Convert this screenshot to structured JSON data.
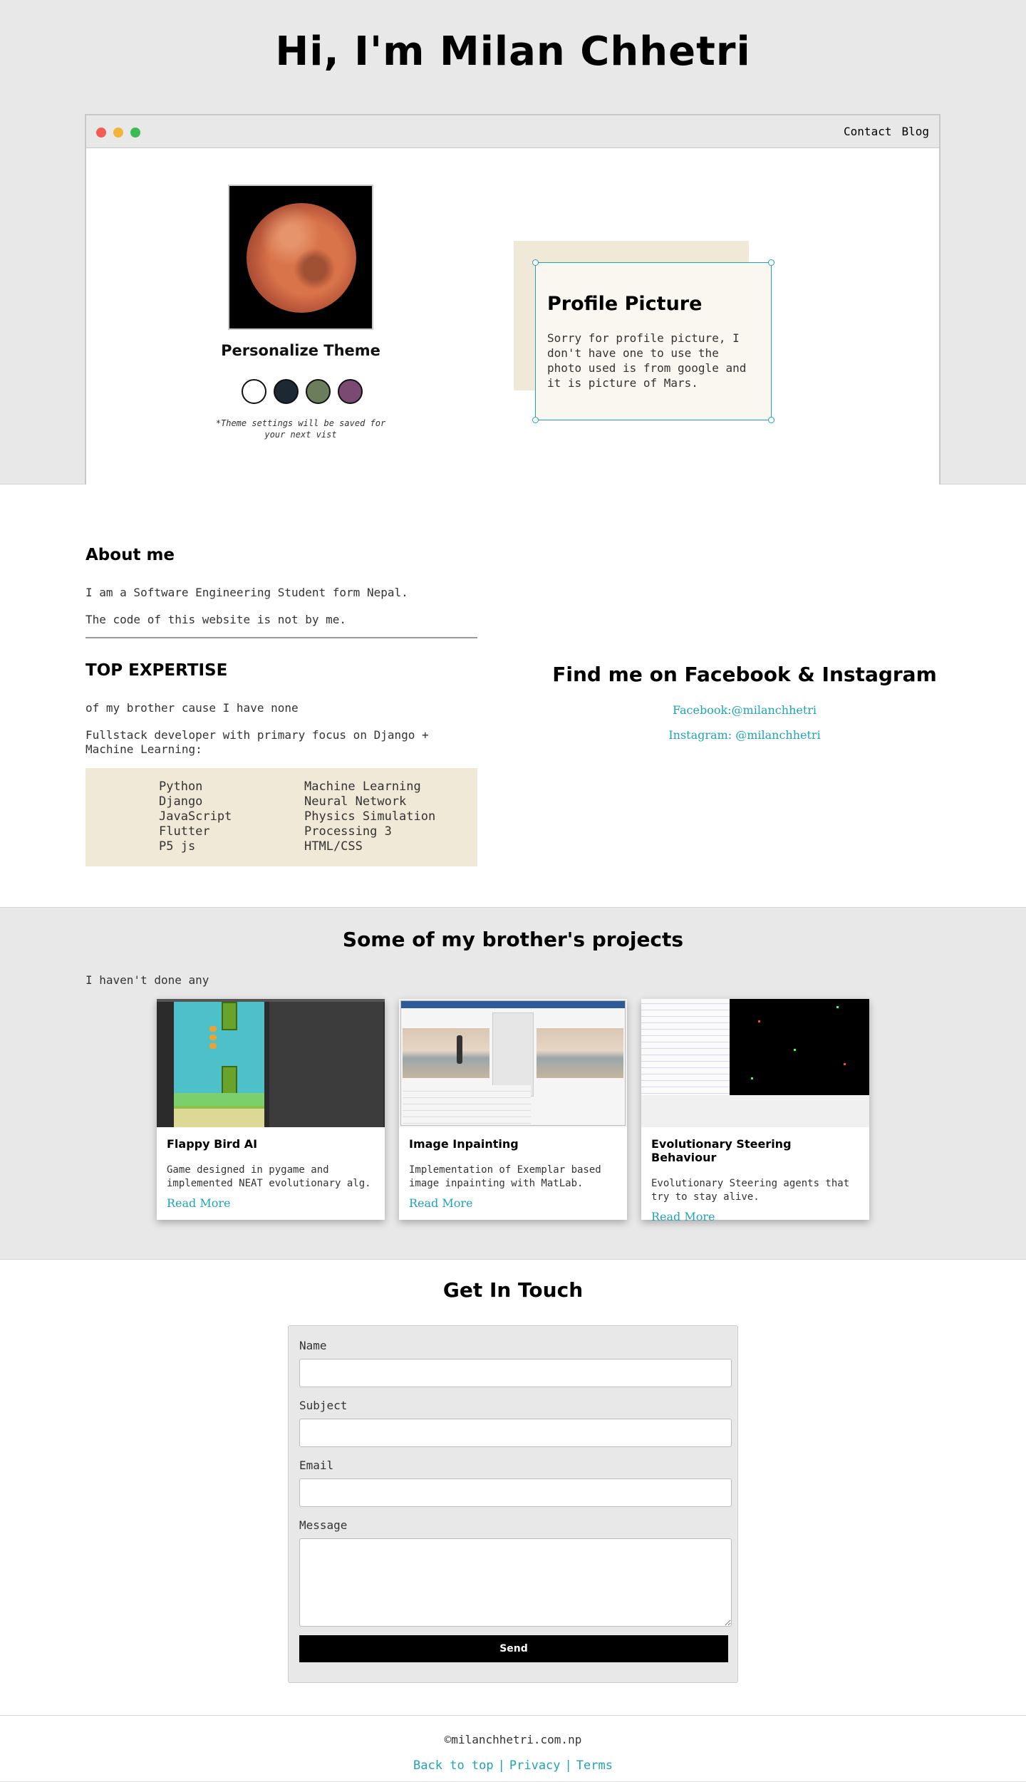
{
  "hero": {
    "title": "Hi, I'm Milan Chhetri",
    "nav": [
      "Contact",
      "Blog"
    ],
    "theme_title": "Personalize Theme",
    "theme_colors": [
      "#ffffff",
      "#1c2833",
      "#6b7d5a",
      "#7a4a72"
    ],
    "theme_note": "*Theme settings will be saved for your next vist",
    "card_title": "Profile Picture",
    "card_text": "Sorry for profile picture, I don't have one to use the photo used is from google and it is picture of Mars."
  },
  "about": {
    "title": "About me",
    "p1": "I am a Software Engineering Student form Nepal.",
    "p2": "The code of this website is not by me.",
    "expertise_title": "TOP EXPERTISE",
    "expertise_p1": "of my brother cause I have none",
    "expertise_p2": "Fullstack developer with primary focus on Django + Machine Learning:",
    "skills_left": [
      "Python",
      "Django",
      "JavaScript",
      "Flutter",
      "P5 js"
    ],
    "skills_right": [
      "Machine Learning",
      "Neural Network",
      "Physics Simulation",
      "Processing 3",
      "HTML/CSS"
    ],
    "social_title": "Find me on Facebook & Instagram",
    "facebook": "Facebook:@milanchhetri",
    "instagram": "Instagram: @milanchhetri"
  },
  "projects": {
    "title": "Some of my brother's projects",
    "subtitle": "I haven't done any",
    "items": [
      {
        "title": "Flappy Bird AI",
        "desc": "Game designed in pygame and implemented NEAT evolutionary alg.",
        "link": "Read More"
      },
      {
        "title": "Image Inpainting",
        "desc": "Implementation of Exemplar based image inpainting with MatLab.",
        "link": "Read More"
      },
      {
        "title": "Evolutionary Steering Behaviour",
        "desc": "Evolutionary Steering agents that try to stay alive.",
        "link": "Read More"
      }
    ]
  },
  "contact": {
    "title": "Get In Touch",
    "labels": {
      "name": "Name",
      "subject": "Subject",
      "email": "Email",
      "message": "Message"
    },
    "values": {
      "name": "",
      "subject": "",
      "email": "",
      "message": ""
    },
    "send": "Send"
  },
  "footer": {
    "copyright": "©milanchhetri.com.np",
    "links": [
      "Back to top",
      "Privacy",
      "Terms"
    ],
    "separator": "|"
  },
  "colors": {
    "accent": "#1fa3b6",
    "sand": "#f0e9d8",
    "background": "#e8e8e8"
  }
}
